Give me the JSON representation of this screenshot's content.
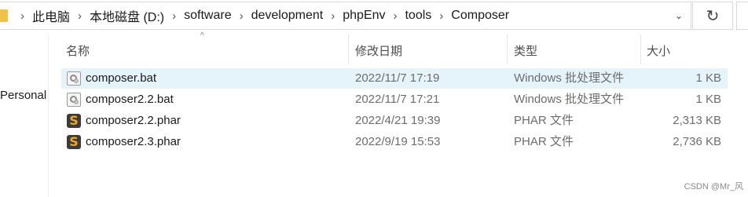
{
  "address_bar": {
    "crumbs": [
      "此电脑",
      "本地磁盘 (D:)",
      "software",
      "development",
      "phpEnv",
      "tools",
      "Composer"
    ],
    "dropdown_icon": "chevron-down-icon",
    "refresh_icon": "refresh-icon"
  },
  "nav": {
    "item": "Personal"
  },
  "columns": {
    "name": "名称",
    "date": "修改日期",
    "type": "类型",
    "size": "大小"
  },
  "files": [
    {
      "name": "composer.bat",
      "date": "2022/11/7 17:19",
      "type": "Windows 批处理文件",
      "size": "1 KB",
      "icon": "batch-file-icon",
      "selected": true
    },
    {
      "name": "composer2.2.bat",
      "date": "2022/11/7 17:21",
      "type": "Windows 批处理文件",
      "size": "1 KB",
      "icon": "batch-file-icon",
      "selected": false
    },
    {
      "name": "composer2.2.phar",
      "date": "2022/4/21 19:39",
      "type": "PHAR 文件",
      "size": "2,313 KB",
      "icon": "phar-file-icon",
      "selected": false
    },
    {
      "name": "composer2.3.phar",
      "date": "2022/9/19 15:53",
      "type": "PHAR 文件",
      "size": "2,736 KB",
      "icon": "phar-file-icon",
      "selected": false
    }
  ],
  "watermark": "CSDN @Mr_风",
  "colors": {
    "selection": "#e5f3fb",
    "phar_icon_glyph": "#f5a623"
  }
}
